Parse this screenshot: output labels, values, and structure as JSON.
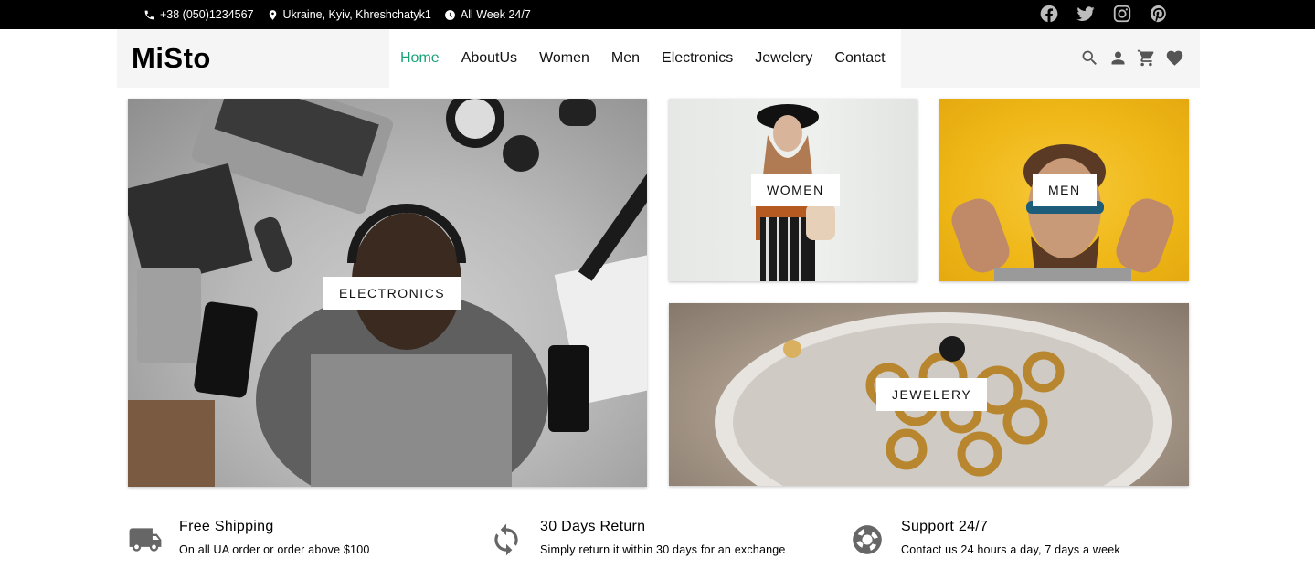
{
  "topbar": {
    "phone": "+38 (050)1234567",
    "address": "Ukraine, Kyiv, Khreshchatyk1",
    "hours": "All Week 24/7",
    "social": [
      "facebook-icon",
      "twitter-icon",
      "instagram-icon",
      "pinterest-icon"
    ]
  },
  "header": {
    "logo": "MiSto",
    "nav": [
      "Home",
      "AboutUs",
      "Women",
      "Men",
      "Electronics",
      "Jewelery",
      "Contact"
    ],
    "active_nav": "Home",
    "icons": [
      "search-icon",
      "user-icon",
      "cart-icon",
      "heart-icon"
    ]
  },
  "tiles": {
    "electronics": "ELECTRONICS",
    "women": "WOMEN",
    "men": "MEN",
    "jewelery": "JEWELERY"
  },
  "features": [
    {
      "title": "Free Shipping",
      "subtitle": "On all UA order or order above $100",
      "icon": "truck-icon"
    },
    {
      "title": "30 Days Return",
      "subtitle": "Simply return it within 30 days for an exchange",
      "icon": "return-arrows-icon"
    },
    {
      "title": "Support 24/7",
      "subtitle": "Contact us 24 hours a day, 7 days a week",
      "icon": "lifebuoy-icon"
    }
  ],
  "colors": {
    "accent": "#1aa37a",
    "topbar_bg": "#000000",
    "header_bg": "#f5f5f5"
  }
}
